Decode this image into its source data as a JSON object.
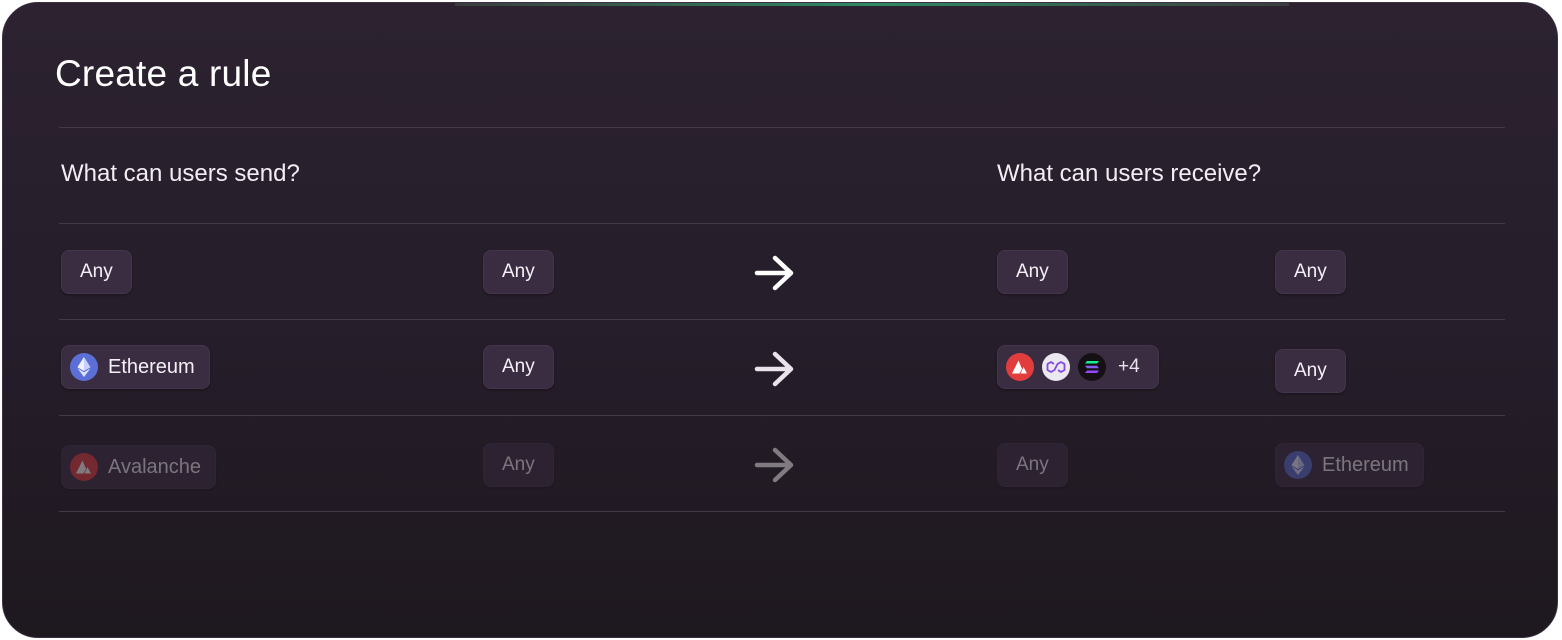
{
  "page": {
    "title": "Create a rule"
  },
  "columns": {
    "send_header": "What can users send?",
    "receive_header": "What can users receive?"
  },
  "rules": [
    {
      "send_chain": "Any",
      "send_asset": "Any",
      "receive_chain": "Any",
      "receive_asset": "Any",
      "faded": false
    },
    {
      "send_chain": "Ethereum",
      "send_chain_icon": "ethereum-icon",
      "send_asset": "Any",
      "receive_chain_icons": [
        "avalanche-icon",
        "polygon-icon",
        "solana-icon"
      ],
      "receive_chain_more": "+4",
      "receive_asset": "Any",
      "faded": false
    },
    {
      "send_chain": "Avalanche",
      "send_chain_icon": "avalanche-icon",
      "send_asset": "Any",
      "receive_chain": "Any",
      "receive_asset": "Ethereum",
      "receive_asset_icon": "ethereum-icon",
      "faded": true
    }
  ],
  "colors": {
    "card_background": "#2a2130",
    "pill_background": "#3a2d42",
    "divider": "#433947",
    "accent_green": "#2d8a63",
    "ethereum": "#5b6fd6",
    "avalanche": "#e23d3d",
    "polygon": "#8247e5",
    "solana_bg": "#141014"
  }
}
